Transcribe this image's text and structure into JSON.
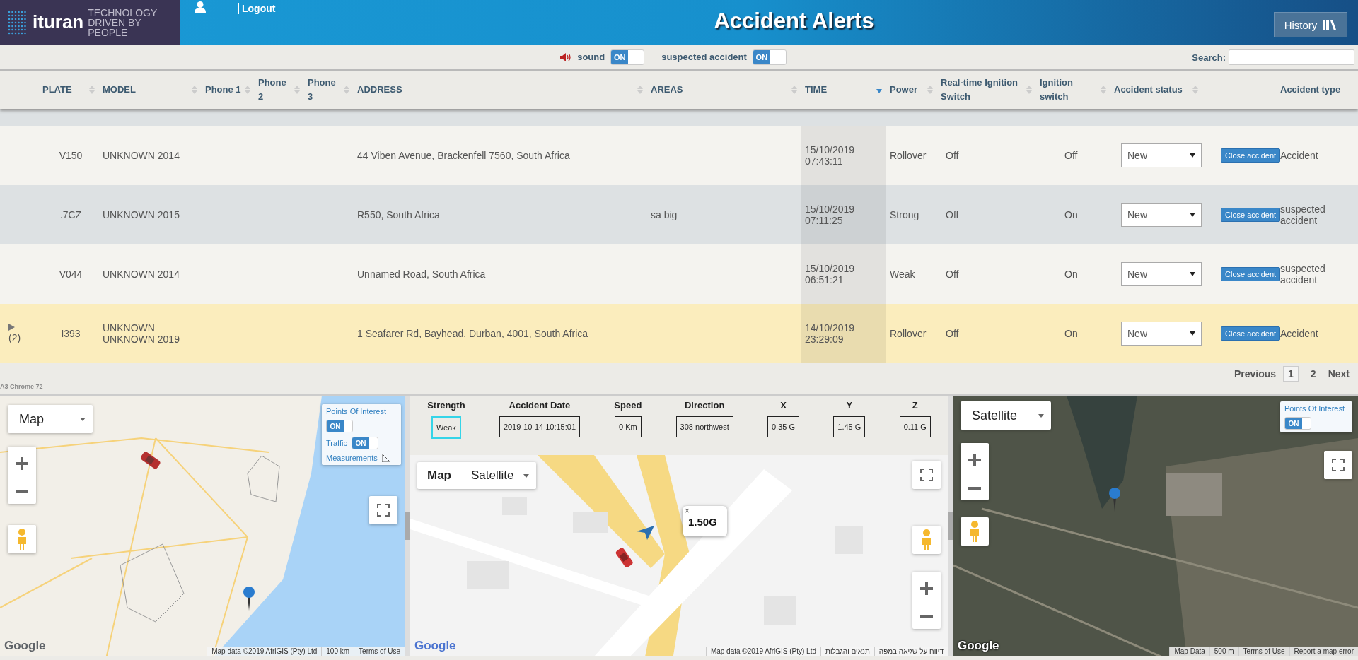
{
  "header": {
    "logo": "ituran",
    "tagline": "TECHNOLOGY DRIVEN BY PEOPLE",
    "logout": "Logout",
    "title": "Accident Alerts",
    "history_button": "History"
  },
  "toolbar": {
    "toggles": [
      {
        "label": "sound",
        "text": "ON",
        "on": true
      },
      {
        "label": "suspected accident",
        "text": "ON",
        "on": true
      }
    ],
    "search": {
      "label": "Search:"
    }
  },
  "table": {
    "columns": [
      {
        "label": "PLATE",
        "sortable": true,
        "sort_descending": false
      },
      {
        "label": "MODEL",
        "sortable": true,
        "sort_descending": false
      },
      {
        "label": "Phone 1",
        "sortable": true,
        "sort_descending": false
      },
      {
        "label": "Phone 2",
        "sortable": true,
        "sort_descending": false
      },
      {
        "label": "Phone 3",
        "sortable": true,
        "sort_descending": false
      },
      {
        "label": "ADDRESS",
        "sortable": true,
        "sort_descending": false
      },
      {
        "label": "AREAS",
        "sortable": true,
        "sort_descending": false
      },
      {
        "label": "TIME",
        "sortable": true,
        "sort_descending": true
      },
      {
        "label": "Power",
        "sortable": true,
        "sort_descending": false
      },
      {
        "label": "Real-time Ignition Switch",
        "sortable": true,
        "sort_descending": false
      },
      {
        "label": "Ignition switch",
        "sortable": true,
        "sort_descending": false
      },
      {
        "label": "Accident status",
        "sortable": true,
        "sort_descending": false
      },
      {
        "label": "Accident type"
      }
    ],
    "rows": [
      {
        "expandable": false,
        "plate": "V150",
        "model": "UNKNOWN 2014",
        "address": "44 Viben Avenue, Brackenfell 7560, South Africa",
        "time": "15/10/2019 07:43:11",
        "power": "Rollover",
        "realtime_ignition": "Off",
        "ignition": "Off",
        "status": "New",
        "action": "Close accident",
        "type": "Accident",
        "selected": false
      },
      {
        "expandable": false,
        "plate": ".7CZ",
        "model": "UNKNOWN 2015",
        "address": "R550, South Africa",
        "areas": "sa big",
        "time": "15/10/2019 07:11:25",
        "power": "Strong",
        "realtime_ignition": "Off",
        "ignition": "On",
        "status": "New",
        "action": "Close accident",
        "type": "suspected accident",
        "selected": false
      },
      {
        "expandable": false,
        "plate": "V044",
        "model": "UNKNOWN 2014",
        "address": "Unnamed Road, South Africa",
        "time": "15/10/2019 06:51:21",
        "power": "Weak",
        "realtime_ignition": "Off",
        "ignition": "On",
        "status": "New",
        "action": "Close accident",
        "type": "suspected accident",
        "selected": false
      },
      {
        "expandable": true,
        "count": "(2)",
        "plate": "I393",
        "model": "UNKNOWN UNKNOWN 2019",
        "address": "1 Seafarer Rd, Bayhead, Durban, 4001, South Africa",
        "time": "14/10/2019 23:29:09",
        "power": "Rollover",
        "realtime_ignition": "Off",
        "ignition": "On",
        "status": "New",
        "action": "Close accident",
        "type": "Accident",
        "selected": true
      }
    ],
    "browser_note": "A3 Chrome 72",
    "pagination": {
      "previous": "Previous",
      "pages": [
        {
          "label": "1",
          "selected": true
        },
        {
          "label": "2",
          "selected": false
        }
      ],
      "next": "Next"
    }
  },
  "left_map": {
    "map_type": "Map",
    "poi": {
      "title": "Points Of Interest",
      "toggle": {
        "text": "ON",
        "on": true
      },
      "traffic": {
        "label": "Traffic",
        "text": "ON",
        "on": true
      },
      "measurements": "Measurements"
    },
    "google": "Google",
    "attribution": [
      "Map data ©2019 AfriGIS (Pty) Ltd",
      "100 km",
      "Terms of Use"
    ]
  },
  "details": {
    "fields": [
      {
        "label": "Strength",
        "value": "Weak",
        "highlighted": true
      },
      {
        "label": "Accident Date",
        "value": "2019-10-14 10:15:01",
        "highlighted": false
      },
      {
        "label": "Speed",
        "value": "0 Km",
        "highlighted": false
      },
      {
        "label": "Direction",
        "value": "308 northwest",
        "highlighted": false
      },
      {
        "label": "X",
        "value": "0.35 G",
        "highlighted": false
      },
      {
        "label": "Y",
        "value": "1.45 G",
        "highlighted": false
      },
      {
        "label": "Z",
        "value": "0.11 G",
        "highlighted": false
      }
    ],
    "map": {
      "types": [
        {
          "label": "Map",
          "selected": true
        },
        {
          "label": "Satellite",
          "selected": false
        }
      ],
      "bubble": "1.50G",
      "bubble_close": "×",
      "google": "Google",
      "map_data": "Map data ©2019 AfriGIS (Pty) Ltd",
      "terms_link": "תנאים והגבלות",
      "report_link": "דיווח על שגיאה במפה"
    }
  },
  "right_map": {
    "map_type": "Satellite",
    "poi": {
      "title": "Points Of Interest",
      "toggle": {
        "text": "ON",
        "on": true
      }
    },
    "google": "Google",
    "attribution": [
      "Map Data",
      "500 m",
      "Terms of Use",
      "Report a map error"
    ]
  }
}
